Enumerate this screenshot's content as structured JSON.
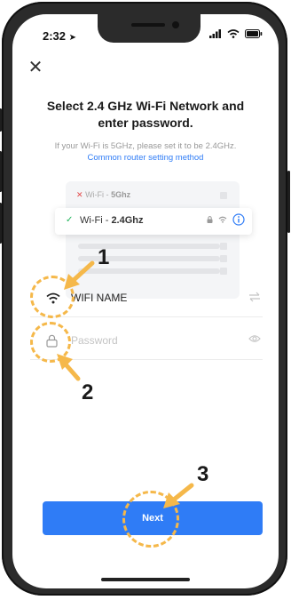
{
  "status_bar": {
    "time": "2:32"
  },
  "header": {
    "title_line1": "Select 2.4 GHz Wi-Fi Network and",
    "title_line2": "enter password.",
    "subtitle": "If your Wi-Fi is 5GHz, please set it to be 2.4GHz.",
    "link": "Common router setting method"
  },
  "illustration": {
    "row_5g_prefix": "Wi-Fi - ",
    "row_5g_band": "5Ghz",
    "row_24_prefix": "Wi-Fi - ",
    "row_24_band": "2.4Ghz"
  },
  "form": {
    "wifi_name": "WIFI NAME",
    "password_placeholder": "Password"
  },
  "annotations": {
    "n1": "1",
    "n2": "2",
    "n3": "3"
  },
  "next_label": "Next",
  "colors": {
    "accent": "#2f7cf6",
    "annotation": "#f5b84a",
    "check": "#1fb35a",
    "error": "#e34a4a"
  }
}
